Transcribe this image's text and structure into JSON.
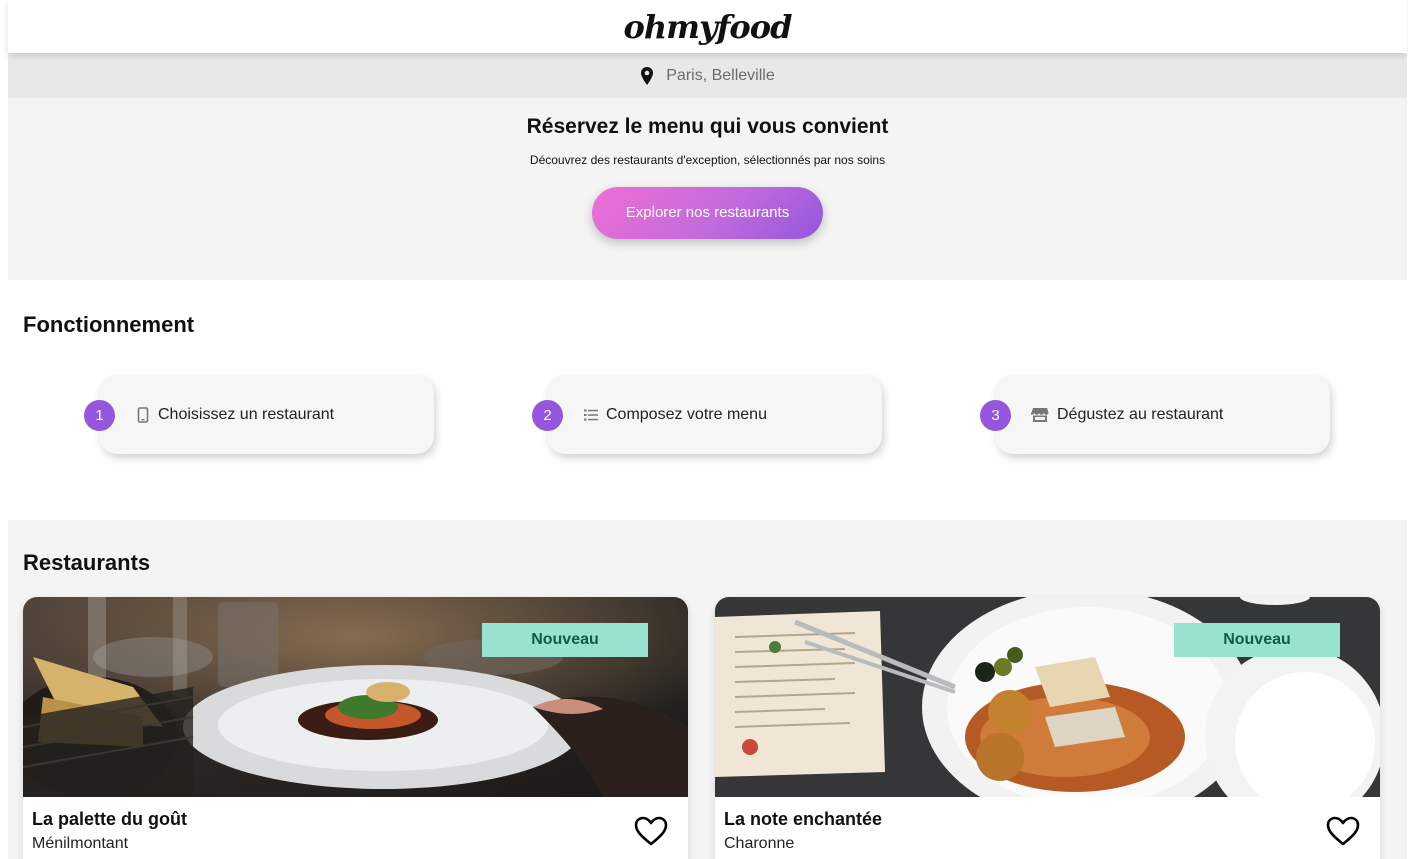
{
  "header": {
    "logo": "ohmyfood"
  },
  "location": {
    "icon": "map-marker-icon",
    "text": "Paris, Belleville"
  },
  "hero": {
    "title": "Réservez le menu qui vous convient",
    "subtitle": "Découvrez des restaurants d'exception, sélectionnés par nos soins",
    "cta_label": "Explorer nos restaurants"
  },
  "howto": {
    "title": "Fonctionnement",
    "steps": [
      {
        "number": "1",
        "icon": "mobile-phone-icon",
        "label": "Choisissez un restaurant"
      },
      {
        "number": "2",
        "icon": "list-icon",
        "label": "Composez votre menu"
      },
      {
        "number": "3",
        "icon": "store-icon",
        "label": "Dégustez au restaurant"
      }
    ]
  },
  "restaurants": {
    "title": "Restaurants",
    "items": [
      {
        "name": "La palette du goût",
        "area": "Ménilmontant",
        "badge": "Nouveau",
        "favorite_icon": "heart-outline-icon"
      },
      {
        "name": "La note enchantée",
        "area": "Charonne",
        "badge": "Nouveau",
        "favorite_icon": "heart-outline-icon"
      }
    ]
  },
  "colors": {
    "accent": "#9356dc",
    "gradient_start": "#ef6ed5",
    "badge_bg": "#99e2d0",
    "badge_text": "#0c5d4a",
    "hero_bg": "#f4f4f4",
    "location_bg": "#e8e8e8"
  }
}
